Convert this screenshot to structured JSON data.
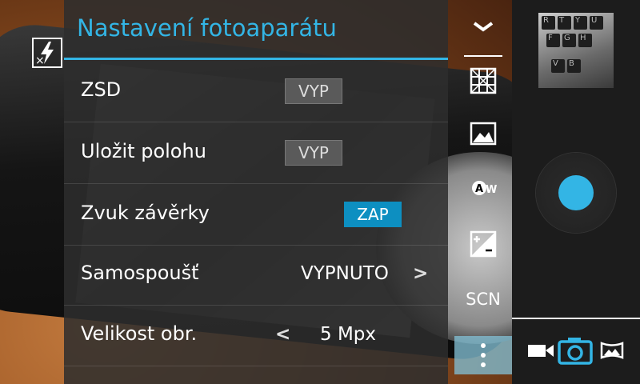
{
  "settings": {
    "title": "Nastavení fotoaparátu",
    "rows": [
      {
        "label": "ZSD",
        "value": "VYP"
      },
      {
        "label": "Uložit polohu",
        "value": "VYP"
      },
      {
        "label": "Zvuk závěrky",
        "value": "ZAP"
      },
      {
        "label": "Samospoušť",
        "value": "VYPNUTO"
      },
      {
        "label": "Velikost obr.",
        "value": "5 Mpx"
      }
    ],
    "next_arrow": ">",
    "prev_arrow": "<"
  },
  "toolbar": {
    "scene_label": "SCN",
    "icons": [
      "collapse-chevron-icon",
      "grid-icon",
      "picture-icon",
      "white-balance-auto-icon",
      "exposure-icon",
      "more-menu-icon"
    ]
  },
  "flash": {
    "icon": "flash-off-icon"
  },
  "modes": [
    "video-mode-icon",
    "camera-mode-icon",
    "panorama-mode-icon"
  ],
  "colors": {
    "accent": "#33b5e5",
    "toggle_on": "#0d8fc1",
    "toggle_off": "#5a5a5a"
  },
  "thumbnail_keys": [
    "R",
    "T",
    "Y",
    "U",
    "F",
    "G",
    "H",
    "V",
    "B"
  ]
}
